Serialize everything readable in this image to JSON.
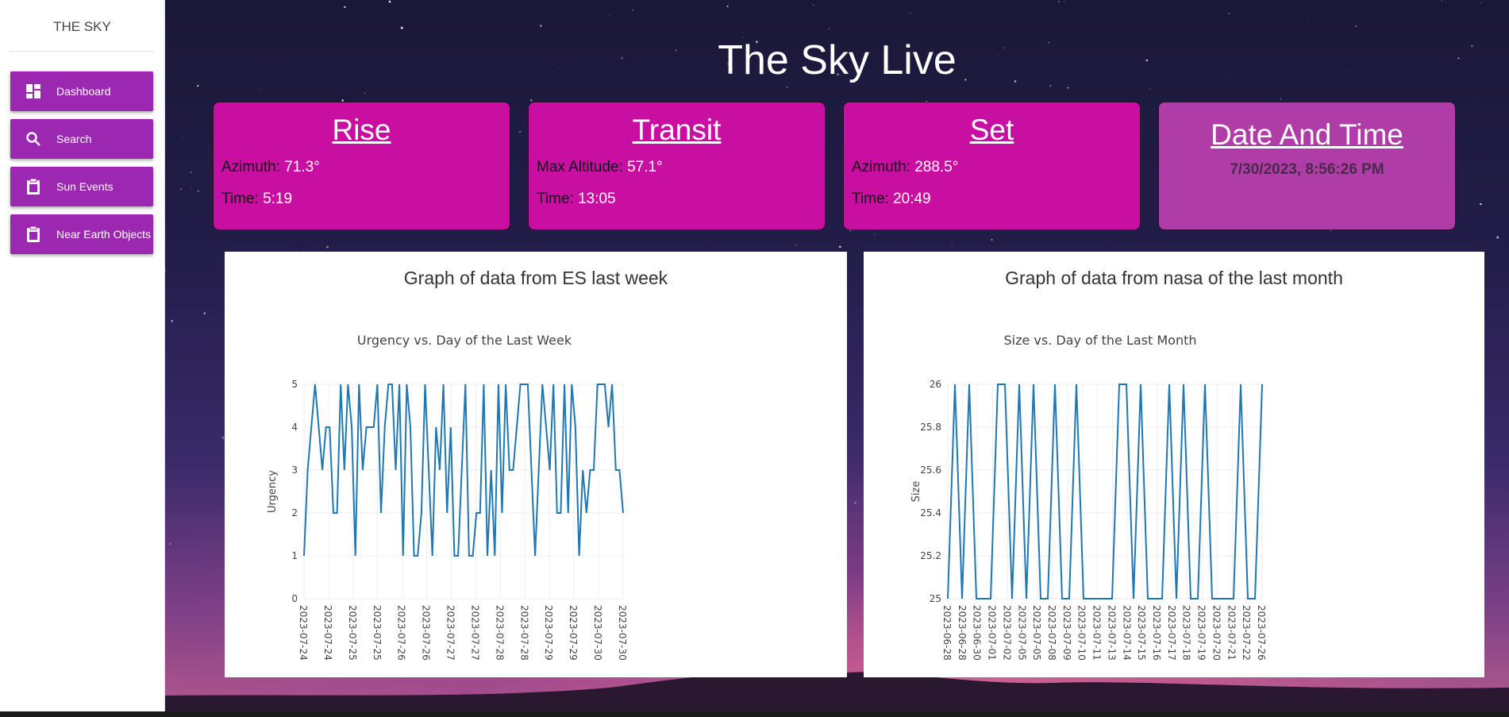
{
  "sidebar": {
    "brand": "THE SKY",
    "items": [
      {
        "label": "Dashboard",
        "icon": "dashboard-icon"
      },
      {
        "label": "Search",
        "icon": "search-icon"
      },
      {
        "label": "Sun Events",
        "icon": "clipboard-icon"
      },
      {
        "label": "Near Earth Objects",
        "icon": "clipboard-icon"
      }
    ]
  },
  "header": {
    "title": "The Sky Live"
  },
  "cards": {
    "rise": {
      "title": "Rise",
      "azimuth_label": "Azimuth:",
      "azimuth": "71.3°",
      "time_label": "Time:",
      "time": "5:19"
    },
    "transit": {
      "title": "Transit",
      "altitude_label": "Max Altitude:",
      "altitude": "57.1°",
      "time_label": "Time:",
      "time": "13:05"
    },
    "set": {
      "title": "Set",
      "azimuth_label": "Azimuth:",
      "azimuth": "288.5°",
      "time_label": "Time:",
      "time": "20:49"
    },
    "datetime": {
      "title": "Date And Time",
      "value": "7/30/2023, 8:56:26 PM"
    }
  },
  "panels": {
    "es": {
      "heading": "Graph of data from ES last week"
    },
    "nasa": {
      "heading": "Graph of data from nasa of the last month"
    }
  },
  "chart_data": [
    {
      "type": "line",
      "title": "Urgency vs. Day of the Last Week",
      "xlabel": "",
      "ylabel": "Urgency",
      "ylim": [
        0,
        5
      ],
      "yticks": [
        0,
        1,
        2,
        3,
        4,
        5
      ],
      "xtick_labels": [
        "2023-07-24",
        "2023-07-24",
        "2023-07-25",
        "2023-07-25",
        "2023-07-26",
        "2023-07-26",
        "2023-07-27",
        "2023-07-27",
        "2023-07-28",
        "2023-07-28",
        "2023-07-29",
        "2023-07-29",
        "2023-07-30",
        "2023-07-30"
      ],
      "series": [
        {
          "values": [
            1,
            3,
            4,
            5,
            4,
            3,
            4,
            4,
            2,
            2,
            5,
            3,
            5,
            4,
            1,
            5,
            3,
            4,
            4,
            4,
            5,
            2,
            4,
            5,
            5,
            3,
            5,
            1,
            5,
            4,
            1,
            1,
            2,
            5,
            3,
            1,
            4,
            3,
            5,
            2,
            4,
            1,
            1,
            3,
            5,
            1,
            1,
            2,
            2,
            5,
            1,
            3,
            1,
            5,
            2,
            5,
            3,
            3,
            4,
            5,
            5,
            5,
            3,
            1,
            3,
            5,
            4,
            3,
            5,
            2,
            2,
            5,
            2,
            5,
            4,
            1,
            3,
            2,
            3,
            3,
            5,
            5,
            5,
            4,
            5,
            3,
            3,
            2
          ]
        }
      ],
      "grid": true
    },
    {
      "type": "line",
      "title": "Size vs. Day of the Last Month",
      "xlabel": "",
      "ylabel": "Size",
      "ylim": [
        25,
        26
      ],
      "yticks": [
        25,
        25.2,
        25.4,
        25.6,
        25.8,
        26
      ],
      "xtick_labels": [
        "2023-06-28",
        "2023-06-28",
        "2023-06-30",
        "2023-07-01",
        "2023-07-02",
        "2023-07-05",
        "2023-07-05",
        "2023-07-08",
        "2023-07-09",
        "2023-07-10",
        "2023-07-11",
        "2023-07-13",
        "2023-07-14",
        "2023-07-15",
        "2023-07-16",
        "2023-07-17",
        "2023-07-18",
        "2023-07-19",
        "2023-07-20",
        "2023-07-21",
        "2023-07-22",
        "2023-07-26"
      ],
      "series": [
        {
          "values": [
            25,
            26,
            25,
            26,
            25,
            25,
            25,
            26,
            26,
            25,
            26,
            25,
            26,
            25,
            25,
            26,
            25,
            25,
            26,
            25,
            25,
            25,
            25,
            25,
            26,
            26,
            25,
            26,
            25,
            25,
            25,
            26,
            25,
            26,
            25,
            25,
            26,
            25,
            25,
            25,
            25,
            26,
            25,
            25,
            26
          ]
        }
      ],
      "grid": true
    }
  ],
  "colors": {
    "sidebar_button": "#9c27b0",
    "card": "#c90fa1",
    "datetime_card": "#b03ca8",
    "series_line": "#1f77b4"
  }
}
